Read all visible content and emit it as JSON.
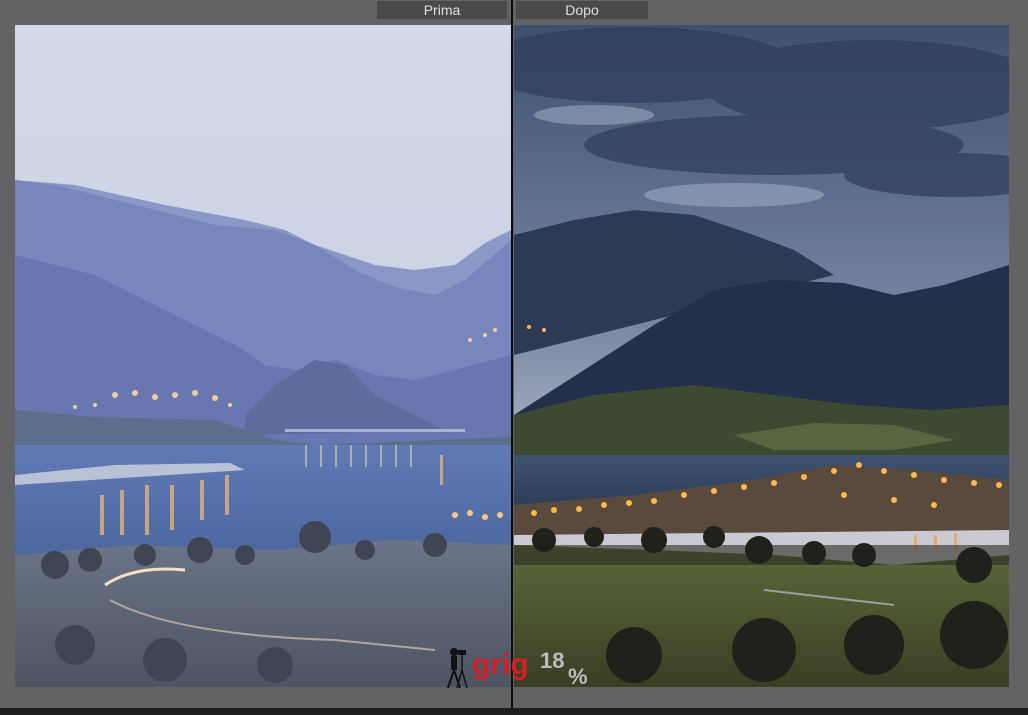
{
  "compare_view": {
    "before_label": "Prima",
    "after_label": "Dopo"
  },
  "watermark": {
    "brand_text": "grig",
    "brand_number": "18",
    "brand_symbol": "%"
  },
  "colors": {
    "background": "#636363",
    "label_tab": "#4a4a4a",
    "divider": "#0c0c0c",
    "watermark_red": "#d21f26",
    "watermark_gray": "#bdbdbd"
  },
  "icons": {
    "watermark_figure": "photographer-tripod-icon"
  }
}
